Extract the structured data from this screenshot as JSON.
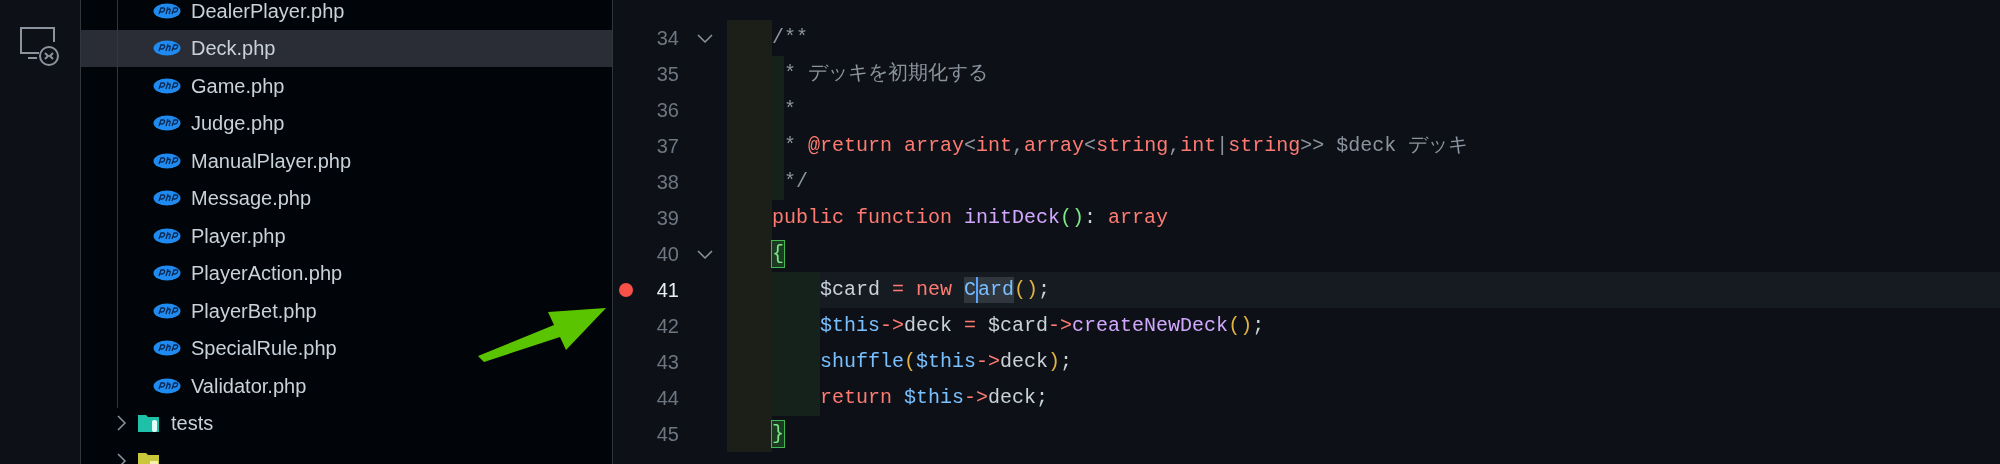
{
  "explorer": {
    "files": [
      {
        "name": "DealerPlayer.php",
        "kind": "file",
        "selected": false
      },
      {
        "name": "Deck.php",
        "kind": "file",
        "selected": true
      },
      {
        "name": "Game.php",
        "kind": "file",
        "selected": false
      },
      {
        "name": "Judge.php",
        "kind": "file",
        "selected": false
      },
      {
        "name": "ManualPlayer.php",
        "kind": "file",
        "selected": false
      },
      {
        "name": "Message.php",
        "kind": "file",
        "selected": false
      },
      {
        "name": "Player.php",
        "kind": "file",
        "selected": false
      },
      {
        "name": "PlayerAction.php",
        "kind": "file",
        "selected": false
      },
      {
        "name": "PlayerBet.php",
        "kind": "file",
        "selected": false
      },
      {
        "name": "SpecialRule.php",
        "kind": "file",
        "selected": false
      },
      {
        "name": "Validator.php",
        "kind": "file",
        "selected": false
      }
    ],
    "folders": [
      {
        "name": "tests",
        "kind": "testfolder",
        "expanded": false
      },
      {
        "kind": "libfolder",
        "expanded": false
      }
    ]
  },
  "editor": {
    "lines": [
      {
        "number": "34",
        "kind": "code",
        "foldable": true,
        "breakpoint": false,
        "current": false,
        "tokens": [
          {
            "text": "/**",
            "kind": "comment"
          }
        ]
      },
      {
        "number": "35",
        "kind": "doc",
        "foldable": false,
        "breakpoint": false,
        "current": false,
        "tokens": [
          {
            "text": "* デッキを初期化する",
            "kind": "comment"
          }
        ]
      },
      {
        "number": "36",
        "kind": "doc",
        "foldable": false,
        "breakpoint": false,
        "current": false,
        "tokens": [
          {
            "text": "*",
            "kind": "comment"
          }
        ]
      },
      {
        "number": "37",
        "kind": "doc",
        "foldable": false,
        "breakpoint": false,
        "current": false,
        "tokens": [
          {
            "text": "* ",
            "kind": "comment"
          },
          {
            "text": "@return array",
            "kind": "keyword"
          },
          {
            "text": "<",
            "kind": "comment"
          },
          {
            "text": "int",
            "kind": "keyword"
          },
          {
            "text": ",",
            "kind": "comment"
          },
          {
            "text": "array",
            "kind": "keyword"
          },
          {
            "text": "<",
            "kind": "comment"
          },
          {
            "text": "string",
            "kind": "keyword"
          },
          {
            "text": ",",
            "kind": "comment"
          },
          {
            "text": "int",
            "kind": "keyword"
          },
          {
            "text": "|",
            "kind": "comment"
          },
          {
            "text": "string",
            "kind": "keyword"
          },
          {
            "text": ">> $deck デッキ",
            "kind": "comment"
          }
        ]
      },
      {
        "number": "38",
        "kind": "doc",
        "foldable": false,
        "breakpoint": false,
        "current": false,
        "tokens": [
          {
            "text": "*/",
            "kind": "comment"
          }
        ]
      },
      {
        "number": "39",
        "kind": "code",
        "foldable": false,
        "breakpoint": false,
        "current": false,
        "tokens": [
          {
            "text": "public function ",
            "kind": "keyword"
          },
          {
            "text": "initDeck",
            "kind": "function"
          },
          {
            "text": "()",
            "kind": "bracket"
          },
          {
            "text": ": ",
            "kind": "plain"
          },
          {
            "text": "array",
            "kind": "keyword"
          }
        ]
      },
      {
        "number": "40",
        "kind": "code",
        "foldable": true,
        "breakpoint": false,
        "current": false,
        "tokens": [
          {
            "text": "{",
            "kind": "matched"
          }
        ]
      },
      {
        "number": "41",
        "kind": "body",
        "foldable": false,
        "breakpoint": true,
        "current": true,
        "tokens": [
          {
            "text": "$card ",
            "kind": "plain"
          },
          {
            "text": "= new ",
            "kind": "keyword"
          },
          {
            "text": "C",
            "kind": "symbol"
          },
          {
            "text": "ard",
            "kind": "cursorsymbol"
          },
          {
            "text": "()",
            "kind": "paren"
          },
          {
            "text": ";",
            "kind": "plain"
          }
        ]
      },
      {
        "number": "42",
        "kind": "body",
        "foldable": false,
        "breakpoint": false,
        "current": false,
        "tokens": [
          {
            "text": "$this",
            "kind": "variable"
          },
          {
            "text": "->",
            "kind": "keyword"
          },
          {
            "text": "deck ",
            "kind": "plain"
          },
          {
            "text": "=",
            "kind": "keyword"
          },
          {
            "text": " $card",
            "kind": "plain"
          },
          {
            "text": "->",
            "kind": "keyword"
          },
          {
            "text": "createNewDeck",
            "kind": "function"
          },
          {
            "text": "()",
            "kind": "paren"
          },
          {
            "text": ";",
            "kind": "plain"
          }
        ]
      },
      {
        "number": "43",
        "kind": "body",
        "foldable": false,
        "breakpoint": false,
        "current": false,
        "tokens": [
          {
            "text": "shuffle",
            "kind": "variable"
          },
          {
            "text": "(",
            "kind": "paren"
          },
          {
            "text": "$this",
            "kind": "variable"
          },
          {
            "text": "->",
            "kind": "keyword"
          },
          {
            "text": "deck",
            "kind": "plain"
          },
          {
            "text": ")",
            "kind": "paren"
          },
          {
            "text": ";",
            "kind": "plain"
          }
        ]
      },
      {
        "number": "44",
        "kind": "body",
        "foldable": false,
        "breakpoint": false,
        "current": false,
        "tokens": [
          {
            "text": "return ",
            "kind": "keyword"
          },
          {
            "text": "$this",
            "kind": "variable"
          },
          {
            "text": "->",
            "kind": "keyword"
          },
          {
            "text": "deck;",
            "kind": "plain"
          }
        ]
      },
      {
        "number": "45",
        "kind": "code",
        "foldable": false,
        "breakpoint": false,
        "current": false,
        "tokens": [
          {
            "text": "}",
            "kind": "matched"
          }
        ]
      }
    ]
  }
}
